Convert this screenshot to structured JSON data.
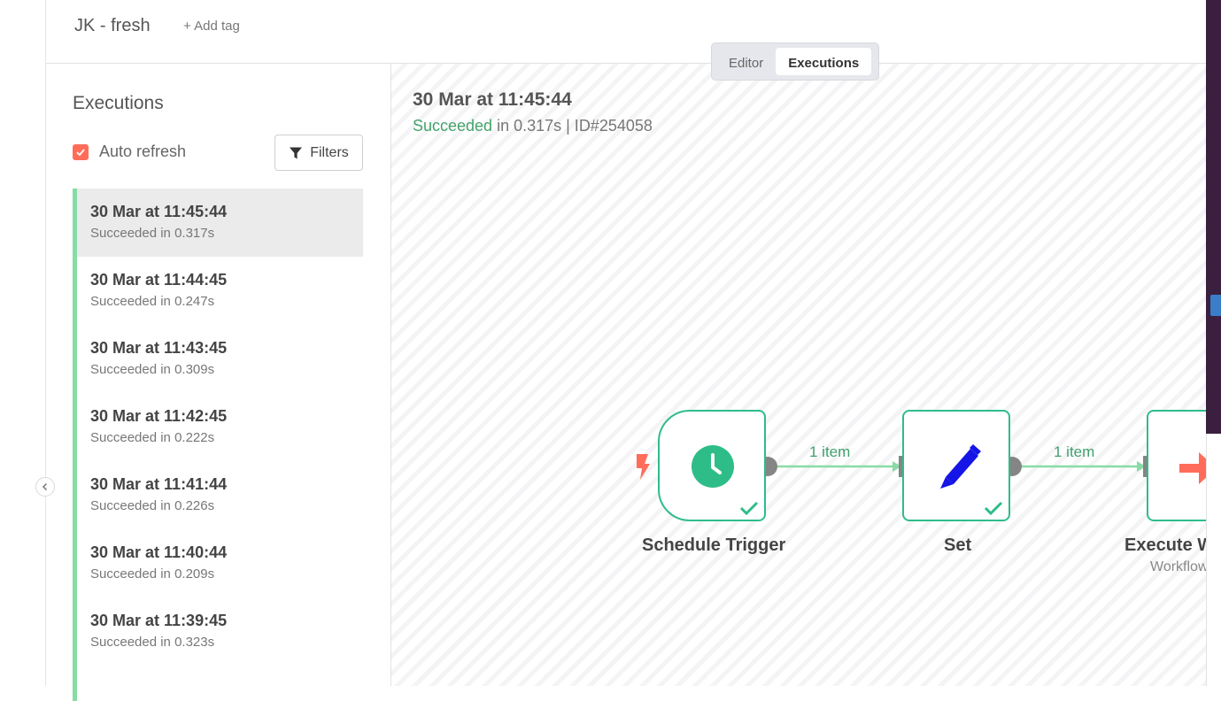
{
  "header": {
    "workflow_name": "JK - fresh",
    "add_tag_label": "+ Add tag"
  },
  "tabs": [
    {
      "label": "Editor",
      "active": false
    },
    {
      "label": "Executions",
      "active": true
    }
  ],
  "sidebar": {
    "title": "Executions",
    "auto_refresh_label": "Auto refresh",
    "auto_refresh_checked": true,
    "filters_label": "Filters",
    "executions": [
      {
        "time": "30 Mar at 11:45:44",
        "status": "Succeeded in 0.317s",
        "selected": true
      },
      {
        "time": "30 Mar at 11:44:45",
        "status": "Succeeded in 0.247s",
        "selected": false
      },
      {
        "time": "30 Mar at 11:43:45",
        "status": "Succeeded in 0.309s",
        "selected": false
      },
      {
        "time": "30 Mar at 11:42:45",
        "status": "Succeeded in 0.222s",
        "selected": false
      },
      {
        "time": "30 Mar at 11:41:44",
        "status": "Succeeded in 0.226s",
        "selected": false
      },
      {
        "time": "30 Mar at 11:40:44",
        "status": "Succeeded in 0.209s",
        "selected": false
      },
      {
        "time": "30 Mar at 11:39:45",
        "status": "Succeeded in 0.323s",
        "selected": false
      }
    ]
  },
  "execution_detail": {
    "time": "30 Mar at 11:45:44",
    "status_word": "Succeeded",
    "duration_text": " in 0.317s | ID#254058"
  },
  "nodes": [
    {
      "label": "Schedule Trigger",
      "icon": "clock-icon"
    },
    {
      "label": "Set",
      "icon": "pencil-icon"
    },
    {
      "label": "Execute Wo",
      "subtitle": "Workflow:",
      "icon": "arrow-right-icon"
    }
  ],
  "edges": [
    {
      "label": "1 item"
    },
    {
      "label": "1 item"
    }
  ],
  "colors": {
    "accent": "#ff6d5a",
    "success": "#2ebd89",
    "edge": "#88dba4",
    "set_icon": "#1515e6"
  }
}
